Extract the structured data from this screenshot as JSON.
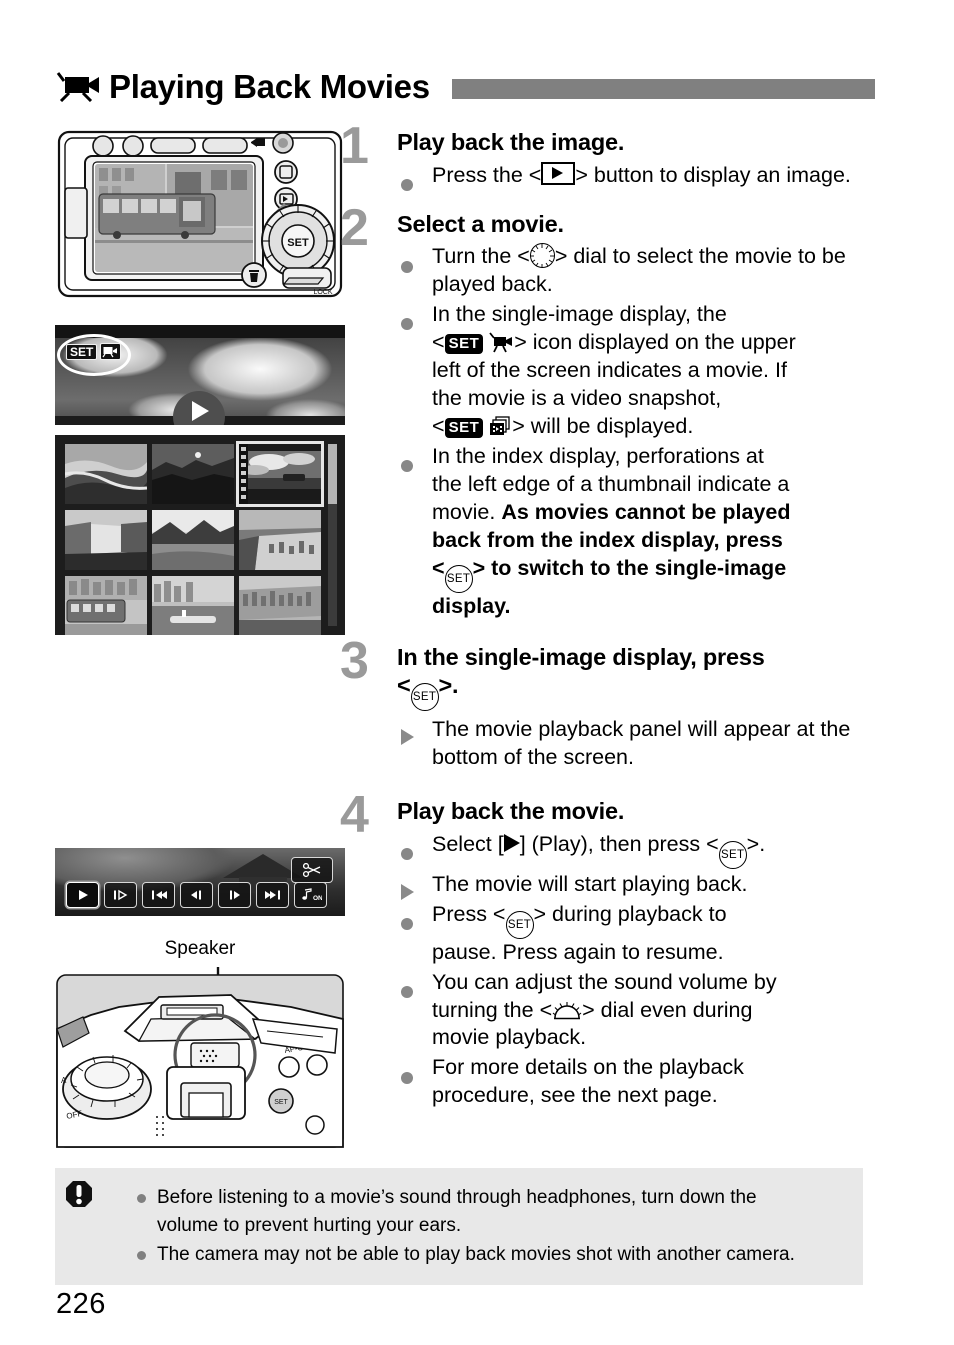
{
  "page": {
    "number": "226"
  },
  "header": {
    "icon": "movie-camera-icon",
    "title": "Playing Back Movies"
  },
  "steps": [
    {
      "number": "1",
      "heading": "Play back the image.",
      "items": [
        {
          "marker": "dot",
          "parts": [
            {
              "t": "text",
              "v": "Press the <"
            },
            {
              "t": "icon",
              "v": "playback-button-icon"
            },
            {
              "t": "text",
              "v": "> button to display an image."
            }
          ],
          "plain": "Press the <[playback]> button to display an image."
        }
      ]
    },
    {
      "number": "2",
      "heading": "Select a movie.",
      "items": [
        {
          "marker": "dot",
          "plain": "Turn the <[quick control dial]> dial to select the movie to be played back."
        },
        {
          "marker": "dot",
          "plain": "In the single-image display, the <[SET][movie]> icon displayed on the upper left of the screen indicates a movie. If the movie is a video snapshot, <[SET][video snapshot]> will be displayed."
        },
        {
          "marker": "dot",
          "plain": "In the index display, perforations at the left edge of a thumbnail indicate a movie. As movies cannot be played back from the index display, press <[SET]> to switch to the single-image display."
        }
      ]
    },
    {
      "number": "3",
      "heading": "In the single-image display, press <[SET]>.",
      "items": [
        {
          "marker": "triangle",
          "plain": "The movie playback panel will appear at the bottom of the screen."
        }
      ]
    },
    {
      "number": "4",
      "heading": "Play back the movie.",
      "items": [
        {
          "marker": "dot",
          "plain": "Select [▶] (Play), then press <[SET]>."
        },
        {
          "marker": "triangle",
          "plain": "The movie will start playing back."
        },
        {
          "marker": "dot",
          "plain": "Press <[SET]> during playback to pause. Press again to resume."
        },
        {
          "marker": "dot",
          "plain": "You can adjust the sound volume by turning the <[main dial]> dial even during movie playback."
        },
        {
          "marker": "dot",
          "plain": "For more details on the playback procedure, see the next page."
        }
      ]
    }
  ],
  "text_fragments": {
    "s1_b1_a": "Press the <",
    "s1_b1_b": "> button to display an",
    "s1_b1_c": "image.",
    "s2_b1_a": "Turn the <",
    "s2_b1_b": "> dial to select the",
    "s2_b1_c": "movie to be played back.",
    "s2_b2_a": "In the single-image display, the",
    "s2_b2_lt": "<",
    "s2_b2_b": "> icon displayed on the upper",
    "s2_b2_c": "left of the screen indicates a movie. If",
    "s2_b2_d": "the movie is a video snapshot,",
    "s2_b2_e": "> will be displayed.",
    "s2_b3_a": "In the index display, perforations at",
    "s2_b3_b": "the left edge of a thumbnail indicate a",
    "s2_b3_c": "movie. ",
    "s2_b3_bold1": "As movies cannot be played",
    "s2_b3_bold2": "back from the index display, press",
    "s2_b3_bold3": "<",
    "s2_b3_bold4": "> to switch to the single-image",
    "s2_b3_bold5": "display.",
    "s3_head_a": "In the single-image display, press",
    "s3_head_b": "<",
    "s3_head_c": ">.",
    "s3_b1": "The movie playback panel will appear at the bottom of the screen.",
    "s4_b1_a": "Select [",
    "s4_b1_b": "] (Play), then press <",
    "s4_b1_c": ">.",
    "s4_b2": "The movie will start playing back.",
    "s4_b3_a": "Press <",
    "s4_b3_b": "> during playback to",
    "s4_b3_c": "pause. Press again to resume.",
    "s4_b4_a": "You can adjust the sound volume by",
    "s4_b4_b": "turning the <",
    "s4_b4_c": "> dial even during",
    "s4_b4_d": "movie playback.",
    "s4_b5_a": "For more details on the playback",
    "s4_b5_b": "procedure, see the next page."
  },
  "figures": {
    "camera_back": {
      "name": "camera-back-illustration",
      "lcd_scene": "tram-street-photo",
      "callout": "arrow-to-playback-button",
      "dial_center_label": "SET",
      "lock_label": "LOCK"
    },
    "single_image_display": {
      "name": "single-image-display",
      "scene": "clouds-sky-photo",
      "badge_set": "SET",
      "badge_icon": "movie-icon",
      "highlight": "white-ellipse-highlight",
      "play_overlay": "play-triangle"
    },
    "index_display": {
      "name": "index-display",
      "columns": 3,
      "rows": 3,
      "selected_index": 2,
      "movie_thumb_has_perforations": true,
      "thumbnails": [
        "beach-cliff",
        "rock-night",
        "movie-clouds-boat",
        "waterfall",
        "canyon-field",
        "coastal-city",
        "tram-street",
        "harbor-boats",
        "hillside-city"
      ]
    },
    "movie_playback_panel": {
      "name": "movie-playback-panel",
      "buttons": [
        {
          "name": "play-button",
          "glyph": "▶",
          "selected": true
        },
        {
          "name": "slow-motion-button",
          "glyph": "▶",
          "selected": false
        },
        {
          "name": "first-frame-button",
          "glyph": "⏮",
          "selected": false
        },
        {
          "name": "previous-frame-button",
          "glyph": "◀❙",
          "selected": false
        },
        {
          "name": "next-frame-button",
          "glyph": "❙▶",
          "selected": false
        },
        {
          "name": "last-frame-button",
          "glyph": "⏭",
          "selected": false
        },
        {
          "name": "background-music-button",
          "glyph": "♪ON",
          "selected": false
        }
      ],
      "edit_button": {
        "name": "edit-scissors-button",
        "glyph": "✂"
      }
    },
    "speaker": {
      "name": "speaker-illustration",
      "label": "Speaker"
    }
  },
  "warning": {
    "icon": "caution-exclamation-icon",
    "items": [
      "Before listening to a movie’s sound through headphones, turn down the volume to prevent hurting your ears.",
      "The camera may not be able to play back movies shot with another camera."
    ],
    "item1_line1": "Before listening to a movie’s sound through headphones, turn down the",
    "item1_line2": "volume to prevent hurting your ears.",
    "item2_line1": "The camera may not be able to play back movies shot with another camera."
  },
  "colors": {
    "title_bar": "#808080",
    "step_number": "#9a9a9a",
    "bullet_dot": "#888888",
    "warning_bg": "#e8e8e8",
    "text": "#000000"
  }
}
